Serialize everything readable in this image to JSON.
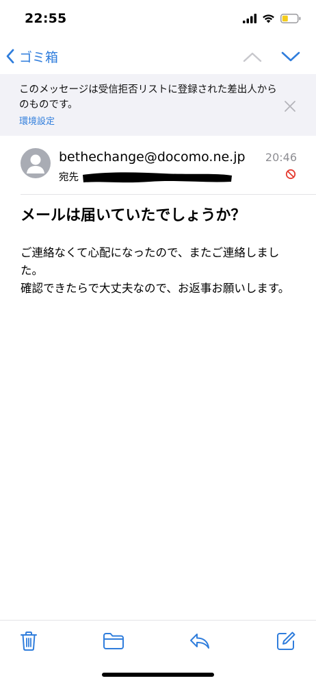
{
  "status_bar": {
    "time": "22:55",
    "icons": [
      "signal-icon",
      "wifi-icon",
      "battery-icon"
    ],
    "battery_color": "#f4cc1b"
  },
  "nav": {
    "back_label": "ゴミ箱",
    "up_icon": "chevron-up-icon",
    "down_icon": "chevron-down-icon",
    "accent_color": "#2f7ddc",
    "disabled_color": "#c7c7cc"
  },
  "banner": {
    "message": "このメッセージは受信拒否リストに登録された差出人からのものです。",
    "settings_link": "環境設定",
    "close_icon": "close-icon"
  },
  "email": {
    "sender": "bethechange@docomo.ne.jp",
    "recipient_label": "宛先",
    "time": "20:46",
    "blocked_icon": "blocked-icon",
    "subject": "メールは届いていたでしょうか？",
    "body": "ご連絡なくて心配になったので、またご連絡しました。\n確認できたらで大丈夫なので、お返事お願いします。"
  },
  "toolbar": {
    "icons": [
      "trash-icon",
      "folder-icon",
      "reply-icon",
      "compose-icon"
    ]
  }
}
